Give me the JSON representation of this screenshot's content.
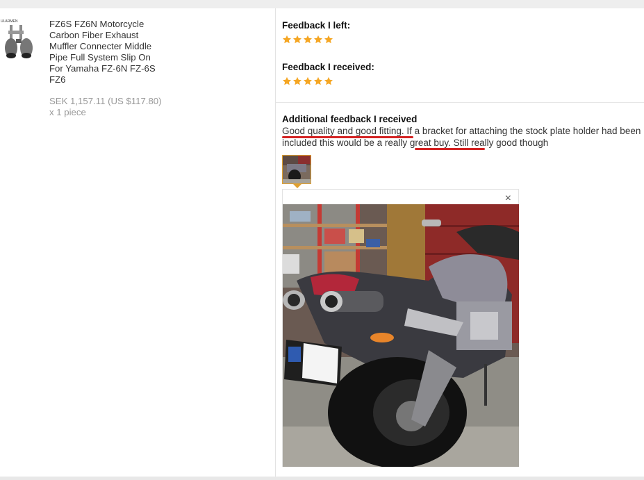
{
  "product": {
    "title_lines": [
      "FZ6S FZ6N Motorcycle",
      "Carbon Fiber Exhaust",
      "Muffler Connecter Middle",
      "Pipe Full System Slip On",
      "For Yamaha FZ-6N FZ-6S",
      "FZ6"
    ],
    "price": "SEK 1,157.11 (US $117.80)",
    "quantity": "x 1 piece"
  },
  "feedback": {
    "left_label": "Feedback I left:",
    "left_stars": 5,
    "received_label": "Feedback I received:",
    "received_stars": 5,
    "star_color": "#f5a623"
  },
  "additional": {
    "title": "Additional feedback I received",
    "part1": "Good quality and good fitting",
    "part2": ". If a bracket for attaching the stock plate holder had been included this would be a ",
    "part3": "really great buy",
    "part4": ". Still really good though",
    "underline_color": "#d32323"
  },
  "preview": {
    "close_label": "×"
  }
}
